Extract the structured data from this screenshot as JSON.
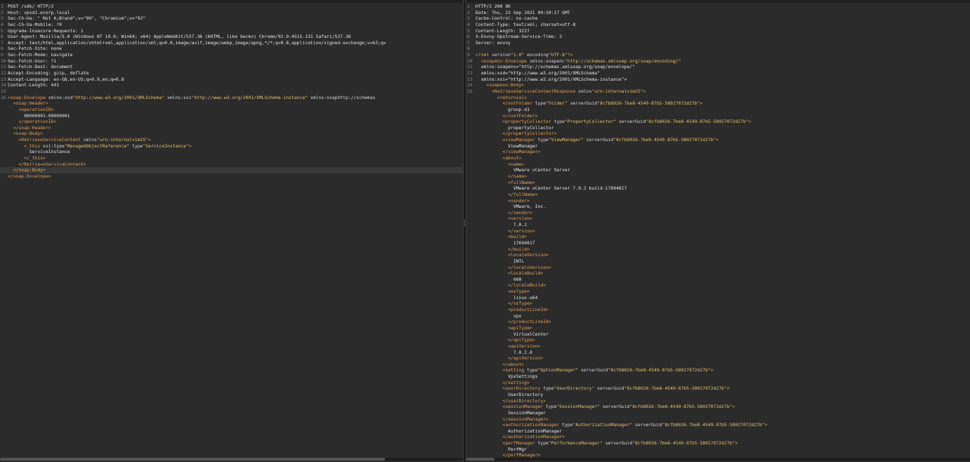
{
  "request": {
    "lines": [
      {
        "n": "1",
        "t": "POST /sdk/ HTTP/2"
      },
      {
        "n": "2",
        "t": "Host: vpsd1.ecorp.local"
      },
      {
        "n": "3",
        "t": "Sec-Ch-Ua: \" Not A;Brand\";v=\"99\", \"Chromium\";v=\"92\""
      },
      {
        "n": "4",
        "t": "Sec-Ch-Ua-Mobile: ?0"
      },
      {
        "n": "5",
        "t": "Upgrade-Insecure-Requests: 1"
      },
      {
        "n": "6",
        "t": "User-Agent: Mozilla/5.0 (Windows NT 10.0; Win64; x64) AppleWebKit/537.36 (KHTML, like Gecko) Chrome/92.0.4515.131 Safari/537.36"
      },
      {
        "n": "7",
        "t": "Accept: text/html,application/xhtml+xml,application/xml;q=0.9,image/avif,image/webp,image/apng,*/*;q=0.8,application/signed-exchange;v=b3;q="
      },
      {
        "n": "8",
        "t": "Sec-Fetch-Site: none"
      },
      {
        "n": "9",
        "t": "Sec-Fetch-Mode: navigate"
      },
      {
        "n": "10",
        "t": "Sec-Fetch-User: ?1"
      },
      {
        "n": "11",
        "t": "Sec-Fetch-Dest: document"
      },
      {
        "n": "12",
        "t": "Accept-Encoding: gzip, deflate"
      },
      {
        "n": "13",
        "t": "Accept-Language: en-GB,en-US;q=0.9,en;q=0.8"
      },
      {
        "n": "14",
        "t": "Content-Length: 441"
      },
      {
        "n": "15",
        "t": ""
      },
      {
        "n": "16",
        "t": "<soap:Envelope xmlns:xsd=\"http://www.w3.org/2001/XMLSchema\" xmlns:xsi=\"http://www.w3.org/2001/XMLSchema-instance\" xmlns:soap=\"http://schemas"
      },
      {
        "n": "",
        "t": "  <soap:Header>"
      },
      {
        "n": "",
        "t": "    <operationID>"
      },
      {
        "n": "",
        "t": "      00000001-00000001"
      },
      {
        "n": "",
        "t": "    </operationID>"
      },
      {
        "n": "",
        "t": "  </soap:Header>"
      },
      {
        "n": "",
        "t": "  <soap:Body>"
      },
      {
        "n": "",
        "t": "    <RetrieveServiceContent xmlns=\"urn:internalvim25\">"
      },
      {
        "n": "",
        "t": "      <_this xsi:type=\"ManagedObjectReference\" type=\"ServiceInstance\">"
      },
      {
        "n": "",
        "t": "        ServiceInstance"
      },
      {
        "n": "",
        "t": "      </_this>"
      },
      {
        "n": "",
        "t": "    </RetrieveServiceContent>"
      },
      {
        "n": "",
        "t": "  </soap:Body>"
      },
      {
        "n": "",
        "t": "</soap:Envelope>"
      }
    ]
  },
  "response": {
    "lines": [
      {
        "n": "1",
        "t": "HTTP/2 200 OK"
      },
      {
        "n": "2",
        "t": "Date: Thu, 23 Sep 2021 09:50:17 GMT"
      },
      {
        "n": "3",
        "t": "Cache-Control: no-cache"
      },
      {
        "n": "4",
        "t": "Content-Type: text/xml; charset=utf-8"
      },
      {
        "n": "5",
        "t": "Content-Length: 3227"
      },
      {
        "n": "6",
        "t": "X-Envoy-Upstream-Service-Time: 2"
      },
      {
        "n": "7",
        "t": "Server: envoy"
      },
      {
        "n": "8",
        "t": ""
      },
      {
        "n": "9",
        "t": "<?xml version=\"1.0\" encoding=\"UTF-8\"?>"
      },
      {
        "n": "10",
        "t": "  <soapenv:Envelope xmlns:soapenc=\"http://schemas.xmlsoap.org/soap/encoding/\""
      },
      {
        "n": "11",
        "t": "  xmlns:soapenv=\"http://schemas.xmlsoap.org/soap/envelope/\""
      },
      {
        "n": "12",
        "t": "  xmlns:xsd=\"http://www.w3.org/2001/XMLSchema\""
      },
      {
        "n": "13",
        "t": "  xmlns:xsi=\"http://www.w3.org/2001/XMLSchema-instance\">"
      },
      {
        "n": "14",
        "t": "    <soapenv:Body>"
      },
      {
        "n": "15",
        "t": "      <RetrieveServiceContentResponse xmlns=\"urn:internalvim25\">"
      },
      {
        "n": "",
        "t": "        <returnval>"
      },
      {
        "n": "",
        "t": "          <rootFolder type=\"Folder\" serverGuid=\"8cfb8026-7be8-4549-87b5-58027072d27b\">"
      },
      {
        "n": "",
        "t": "            group-d1"
      },
      {
        "n": "",
        "t": "          </rootFolder>"
      },
      {
        "n": "",
        "t": "          <propertyCollector type=\"PropertyCollector\" serverGuid=\"8cfb8026-7be8-4549-87b5-58027072d27b\">"
      },
      {
        "n": "",
        "t": "            propertyCollector"
      },
      {
        "n": "",
        "t": "          </propertyCollector>"
      },
      {
        "n": "",
        "t": "          <viewManager type=\"ViewManager\" serverGuid=\"8cfb8026-7be8-4549-87b5-58027072d27b\">"
      },
      {
        "n": "",
        "t": "            ViewManager"
      },
      {
        "n": "",
        "t": "          </viewManager>"
      },
      {
        "n": "",
        "t": "          <about>"
      },
      {
        "n": "",
        "t": "            <name>"
      },
      {
        "n": "",
        "t": "              VMware vCenter Server"
      },
      {
        "n": "",
        "t": "            </name>"
      },
      {
        "n": "",
        "t": "            <fullName>"
      },
      {
        "n": "",
        "t": "              VMware vCenter Server 7.0.2 build-17694817"
      },
      {
        "n": "",
        "t": "            </fullName>"
      },
      {
        "n": "",
        "t": "            <vendor>"
      },
      {
        "n": "",
        "t": "              VMware, Inc."
      },
      {
        "n": "",
        "t": "            </vendor>"
      },
      {
        "n": "",
        "t": "            <version>"
      },
      {
        "n": "",
        "t": "              7.0.2"
      },
      {
        "n": "",
        "t": "            </version>"
      },
      {
        "n": "",
        "t": "            <build>"
      },
      {
        "n": "",
        "t": "              17694817"
      },
      {
        "n": "",
        "t": "            </build>"
      },
      {
        "n": "",
        "t": "            <localeVersion>"
      },
      {
        "n": "",
        "t": "              INTL"
      },
      {
        "n": "",
        "t": "            </localeVersion>"
      },
      {
        "n": "",
        "t": "            <localeBuild>"
      },
      {
        "n": "",
        "t": "              000"
      },
      {
        "n": "",
        "t": "            </localeBuild>"
      },
      {
        "n": "",
        "t": "            <osType>"
      },
      {
        "n": "",
        "t": "              linux-x64"
      },
      {
        "n": "",
        "t": "            </osType>"
      },
      {
        "n": "",
        "t": "            <productLineId>"
      },
      {
        "n": "",
        "t": "              vpx"
      },
      {
        "n": "",
        "t": "            </productLineId>"
      },
      {
        "n": "",
        "t": "            <apiType>"
      },
      {
        "n": "",
        "t": "              VirtualCenter"
      },
      {
        "n": "",
        "t": "            </apiType>"
      },
      {
        "n": "",
        "t": "            <apiVersion>"
      },
      {
        "n": "",
        "t": "              7.0.2.0"
      },
      {
        "n": "",
        "t": "            </apiVersion>"
      },
      {
        "n": "",
        "t": "          </about>"
      },
      {
        "n": "",
        "t": "          <setting type=\"OptionManager\" serverGuid=\"8cfb8026-7be8-4549-87b5-58027072d27b\">"
      },
      {
        "n": "",
        "t": "            VpxSettings"
      },
      {
        "n": "",
        "t": "          </setting>"
      },
      {
        "n": "",
        "t": "          <userDirectory type=\"UserDirectory\" serverGuid=\"8cfb8026-7be8-4549-87b5-58027072d27b\">"
      },
      {
        "n": "",
        "t": "            UserDirectory"
      },
      {
        "n": "",
        "t": "          </userDirectory>"
      },
      {
        "n": "",
        "t": "          <sessionManager type=\"SessionManager\" serverGuid=\"8cfb8026-7be8-4549-87b5-58027072d27b\">"
      },
      {
        "n": "",
        "t": "            SessionManager"
      },
      {
        "n": "",
        "t": "          </sessionManager>"
      },
      {
        "n": "",
        "t": "          <authorizationManager type=\"AuthorizationManager\" serverGuid=\"8cfb8026-7be8-4549-87b5-58027072d27b\">"
      },
      {
        "n": "",
        "t": "            AuthorizationManager"
      },
      {
        "n": "",
        "t": "          </authorizationManager>"
      },
      {
        "n": "",
        "t": "          <perfManager type=\"PerformanceManager\" serverGuid=\"8cfb8026-7be8-4549-87b5-58027072d27b\">"
      },
      {
        "n": "",
        "t": "            PerfMgr"
      },
      {
        "n": "",
        "t": "          </perfManager>"
      }
    ]
  },
  "theme": {
    "background": "#2b2b2b",
    "tag": "#e0a25c",
    "value": "#e3c16f",
    "text": "#d6d6d6"
  }
}
